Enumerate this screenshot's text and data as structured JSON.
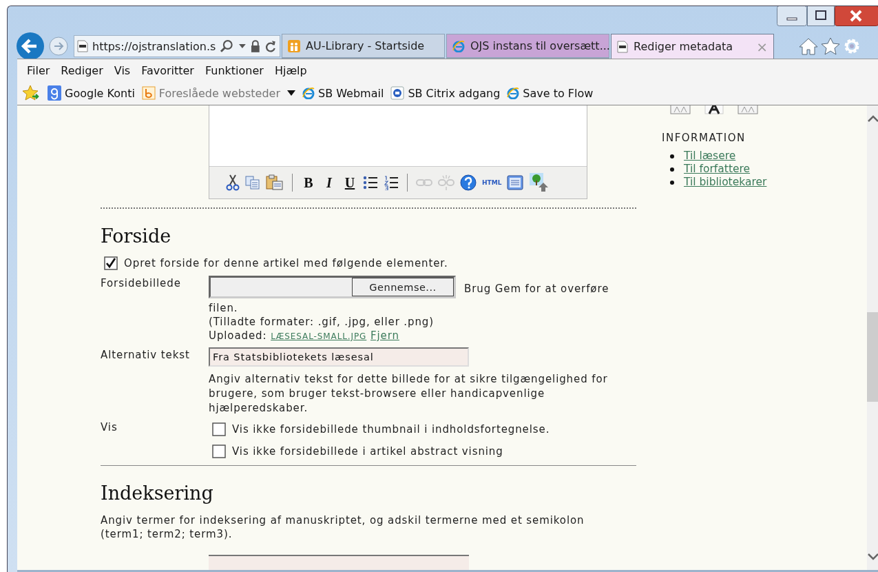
{
  "browser": {
    "address": "https://ojstranslation.s",
    "tabs": [
      {
        "label": "AU-Library - Startside",
        "kind": "library",
        "color": "#c9d6e6",
        "selected": false
      },
      {
        "label": "OJS instans til oversætt...",
        "kind": "ie",
        "color": "#c8a4d6",
        "selected": false
      },
      {
        "label": "Rediger metadata",
        "kind": "pkp",
        "color": "#f3e3f6",
        "selected": true,
        "close": "×"
      }
    ],
    "menu": [
      "Filer",
      "Rediger",
      "Vis",
      "Favoritter",
      "Funktioner",
      "Hjælp"
    ],
    "favorites": [
      {
        "label": "Google Konti",
        "kind": "google",
        "disabled": false
      },
      {
        "label": "Foreslåede websteder",
        "kind": "suggested",
        "disabled": true,
        "dropdown": true
      },
      {
        "label": "SB Webmail",
        "kind": "ie",
        "disabled": false
      },
      {
        "label": "SB Citrix adgang",
        "kind": "citrix",
        "disabled": false
      },
      {
        "label": "Save to Flow",
        "kind": "ie",
        "disabled": false
      }
    ]
  },
  "editor": {
    "toolbar": [
      {
        "kind": "cut",
        "disabled": false
      },
      {
        "kind": "copy",
        "disabled": false
      },
      {
        "kind": "paste",
        "disabled": false
      },
      {
        "kind": "separator"
      },
      {
        "kind": "bold",
        "label": "B",
        "disabled": false
      },
      {
        "kind": "italic",
        "label": "I",
        "disabled": false
      },
      {
        "kind": "underline",
        "label": "U",
        "disabled": false
      },
      {
        "kind": "bullets",
        "disabled": false
      },
      {
        "kind": "numbers",
        "disabled": false
      },
      {
        "kind": "separator"
      },
      {
        "kind": "link",
        "disabled": true
      },
      {
        "kind": "unlink",
        "disabled": true
      },
      {
        "kind": "help",
        "disabled": false
      },
      {
        "kind": "html",
        "label": "HTML",
        "disabled": false
      },
      {
        "kind": "media",
        "disabled": false
      },
      {
        "kind": "image",
        "disabled": false
      }
    ]
  },
  "cover": {
    "heading": "Forside",
    "enable": {
      "label": "Opret forside for denne artikel med følgende elementer.",
      "checked": true
    },
    "image": {
      "label": "Forsidebillede",
      "browse": "Gennemse...",
      "hint": "Brug Gem for at overføre",
      "hint_wrap": "filen.",
      "formats": "(Tilladte formater: .gif, .jpg, eller .png)",
      "uploaded_label": "Uploaded:",
      "file": "LÆSESAL-SMALL.JPG",
      "remove": "Fjern"
    },
    "alt": {
      "label": "Alternativ tekst",
      "value": "Fra Statsbibliotekets læsesal",
      "help": "Angiv alternativ tekst for dette billede for at sikre tilgængelighed for brugere, som bruger tekst-browsere eller handicapvenlige hjælperedskaber."
    },
    "display": {
      "label": "Vis",
      "options": [
        {
          "label": "Vis ikke forsidebillede thumbnail i indholdsfortegnelse.",
          "checked": false
        },
        {
          "label": "Vis ikke forsidebillede i artikel abstract visning",
          "checked": false
        }
      ]
    }
  },
  "indexing": {
    "heading": "Indeksering",
    "help": "Angiv termer for indeksering af manuskriptet, og adskil termerne med et semikolon (term1; term2; term3)."
  },
  "sidebar": {
    "heading": "INFORMATION",
    "links": [
      "Til læsere",
      "Til forfattere",
      "Til bibliotekarer"
    ]
  }
}
